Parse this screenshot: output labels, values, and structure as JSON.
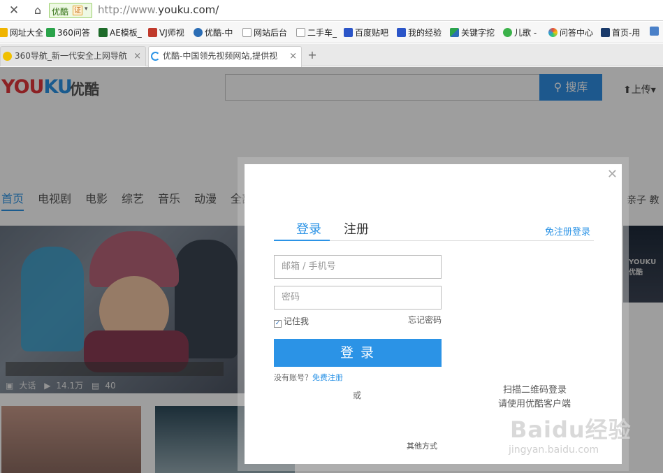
{
  "address_bar": {
    "site_name": "优酷",
    "cert": "证",
    "url_proto": "http://www.",
    "url_host": "youku.com/"
  },
  "bookmarks": [
    "网址大全",
    "360问答",
    "AE模板_",
    "VJ师视",
    "优酷-中",
    "网站后台",
    "二手车_",
    "百度贴吧",
    "我的经验",
    "关键字挖",
    "儿歌 -",
    "问答中心",
    "首页-用"
  ],
  "tabs": [
    {
      "label": "360导航_新一代安全上网导航"
    },
    {
      "label": "优酷-中国领先视频网站,提供视"
    }
  ],
  "page": {
    "logo_en_y": "YOU",
    "logo_en_ku": "KU",
    "logo_cn": "优酷",
    "search_button": "搜库",
    "upload": "上传",
    "nav": [
      "首页",
      "电视剧",
      "电影",
      "综艺",
      "音乐",
      "动漫",
      "全部"
    ],
    "nav_right": "亲子 教",
    "hero_meta": {
      "tag": "大话",
      "plays": "14.1万",
      "comments": "40"
    },
    "side_logo": "YOUKU优酷"
  },
  "modal": {
    "tab_login": "登录",
    "tab_register": "注册",
    "no_register_login": "免注册登录",
    "email_placeholder": "邮箱 / 手机号",
    "password_placeholder": "密码",
    "remember": "记住我",
    "forgot": "忘记密码",
    "login_button": "登 录",
    "no_account": "没有账号？",
    "free_register": "免费注册",
    "or": "或",
    "qr_line1": "扫描二维码登录",
    "qr_line2": "请使用优酷客户端",
    "other": "其他方式"
  },
  "watermark": {
    "main": "Baidu经验",
    "sub": "jingyan.baidu.com"
  }
}
